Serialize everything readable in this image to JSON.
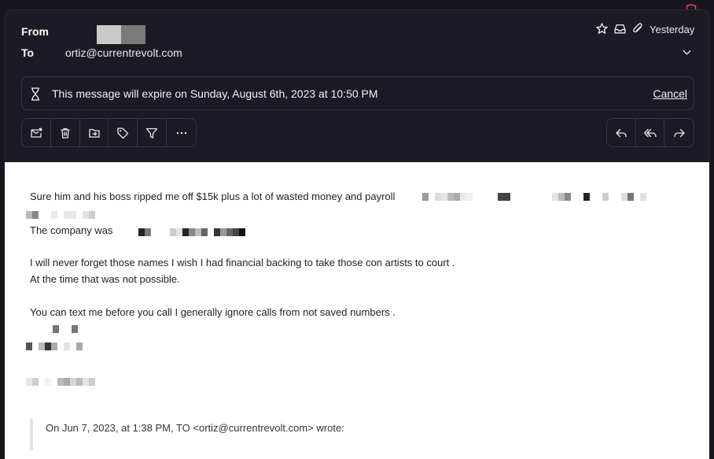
{
  "header": {
    "from_label": "From",
    "to_label": "To",
    "to_address": "ortiz@currentrevolt.com",
    "date": "Yesterday"
  },
  "expiration": {
    "message": "This message will expire on Sunday, August 6th, 2023 at 10:50 PM",
    "cancel_label": "Cancel"
  },
  "toolbar": {
    "actions": [
      "mark-unread",
      "delete",
      "move",
      "label",
      "filter",
      "more"
    ],
    "reply_actions": [
      "reply",
      "reply-all",
      "forward"
    ]
  },
  "body": {
    "line1": "Sure him and his boss ripped me off $15k plus a lot of wasted money and payroll",
    "line2": "The company was",
    "line3": "I will never forget those names I wish I had financial backing to take those con artists to court .",
    "line4": "At the time that was not possible.",
    "line5": "You can text me before you call I generally ignore calls from not saved numbers .",
    "quote": "On Jun 7, 2023, at 1:38 PM, TO <ortiz@currentrevolt.com> wrote:"
  },
  "colors": {
    "header_bg": "#1c1a24",
    "accent_red": "#e0455b",
    "body_bg": "#ffffff"
  }
}
